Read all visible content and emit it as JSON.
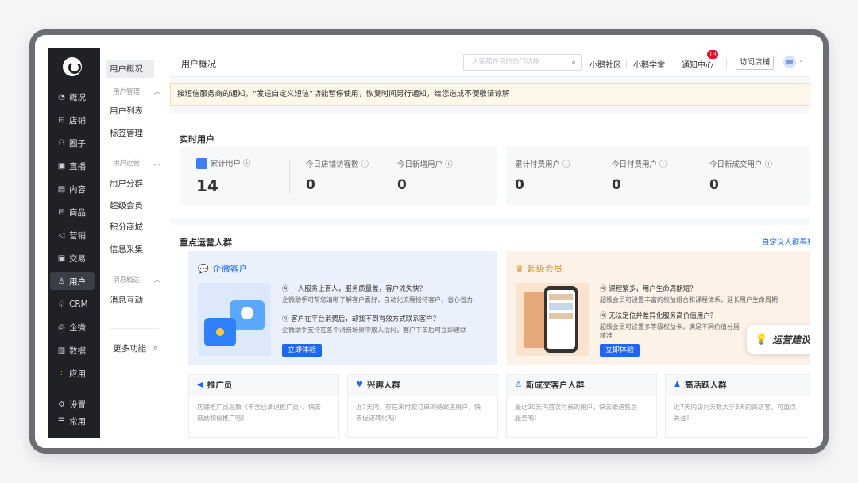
{
  "nav": {
    "items": [
      {
        "icon": "pie-chart-icon",
        "glyph": "◔",
        "label": "概况"
      },
      {
        "icon": "store-icon",
        "glyph": "⊟",
        "label": "店铺"
      },
      {
        "icon": "circle-group-icon",
        "glyph": "⚇",
        "label": "圈子"
      },
      {
        "icon": "live-icon",
        "glyph": "▣",
        "label": "直播"
      },
      {
        "icon": "content-icon",
        "glyph": "▤",
        "label": "内容"
      },
      {
        "icon": "goods-icon",
        "glyph": "⊟",
        "label": "商品"
      },
      {
        "icon": "marketing-icon",
        "glyph": "◁",
        "label": "营销"
      },
      {
        "icon": "trade-icon",
        "glyph": "▣",
        "label": "交易"
      },
      {
        "icon": "user-icon",
        "glyph": "♙",
        "label": "用户"
      },
      {
        "icon": "crm-icon",
        "glyph": "♧",
        "label": "CRM"
      },
      {
        "icon": "wecom-icon",
        "glyph": "◎",
        "label": "企微"
      },
      {
        "icon": "data-icon",
        "glyph": "▥",
        "label": "数据"
      },
      {
        "icon": "apps-icon",
        "glyph": "⁘",
        "label": "应用"
      },
      {
        "icon": "settings-icon",
        "glyph": "⚙",
        "label": "设置"
      },
      {
        "icon": "menu-icon",
        "glyph": "☰",
        "label": "常用"
      }
    ]
  },
  "sub": {
    "overview": "用户概况",
    "group1": "用户管理",
    "user_list": "用户列表",
    "tag_manage": "标签管理",
    "group2": "用户运营",
    "segments": "用户分群",
    "super_member": "超级会员",
    "points_mall": "积分商城",
    "info_collect": "信息采集",
    "group3": "消息触达",
    "message": "消息互动",
    "more": "更多功能"
  },
  "top": {
    "title": "用户概况",
    "search_placeholder": "大家都在用的热门功能",
    "community": "小鹅社区",
    "academy": "小鹅学堂",
    "notify": "通知中心",
    "notify_count": "13",
    "visit_store": "访问店铺"
  },
  "notice": "接短信服务商的通知，“发送自定义短信”功能暂停使用，恢复时间另行通知，给您造成不便敬请谅解",
  "realtime": {
    "title": "实时用户",
    "stats": [
      {
        "label": "累计用户 ⓘ",
        "value": "14"
      },
      {
        "label": "今日店铺访客数 ⓘ",
        "value": "0"
      },
      {
        "label": "今日新增用户 ⓘ",
        "value": "0"
      },
      {
        "label": "累计付费用户 ⓘ",
        "value": "0"
      },
      {
        "label": "今日付费用户 ⓘ",
        "value": "0"
      },
      {
        "label": "今日新成交用户 ⓘ",
        "value": "0"
      }
    ]
  },
  "groups": {
    "title": "重点运营人群",
    "custom_link": "自定义人群看板",
    "wecom": {
      "title": "企微客户",
      "q1": "一人服务上百人，服务质量差，客户流失快？",
      "a1": "企微助手可帮您清晰了解客户喜好，自动化流程接待客户，省心省力",
      "q2": "客户在平台消费后，却找不到有效方式联系客户？",
      "a2": "企微助手支持在各个消费场景中放入活码，客户下单后可立即建联",
      "btn": "立即体验"
    },
    "vip": {
      "title": "超级会员",
      "q1": "课程繁多，用户生命周期短？",
      "a1": "超级会员可设置丰富的权益组合和课程体系，延长用户生命周期",
      "q2": "无法定位并差异化服务高价值用户？",
      "a2": "超级会员可设置多等级权益卡，满足不同价值分层",
      "a2b": "精准",
      "btn": "立即体验"
    },
    "mini": [
      {
        "icon": "promoter-icon",
        "glyph": "◀",
        "title": "推广员",
        "desc1": "店铺推广员总数（不含已清退推广员），快去",
        "desc2": "鼓励积极推广吧！"
      },
      {
        "icon": "interest-icon",
        "glyph": "♥",
        "title": "兴趣人群",
        "desc1": "近7天内，存在未付款订单的待跟进用户，快",
        "desc2": "去促进转化吧！"
      },
      {
        "icon": "new-customer-icon",
        "glyph": "♙",
        "title": "新成交客户人群",
        "desc1": "最近30天内首次付费的用户，快去跟进售后",
        "desc2": "服务吧！"
      },
      {
        "icon": "active-icon",
        "glyph": "♟",
        "title": "高活跃人群",
        "desc1": "近7天内访问天数大于3天的高访客，可重点",
        "desc2": "关注！"
      }
    ]
  },
  "float_tip": "运营建议"
}
